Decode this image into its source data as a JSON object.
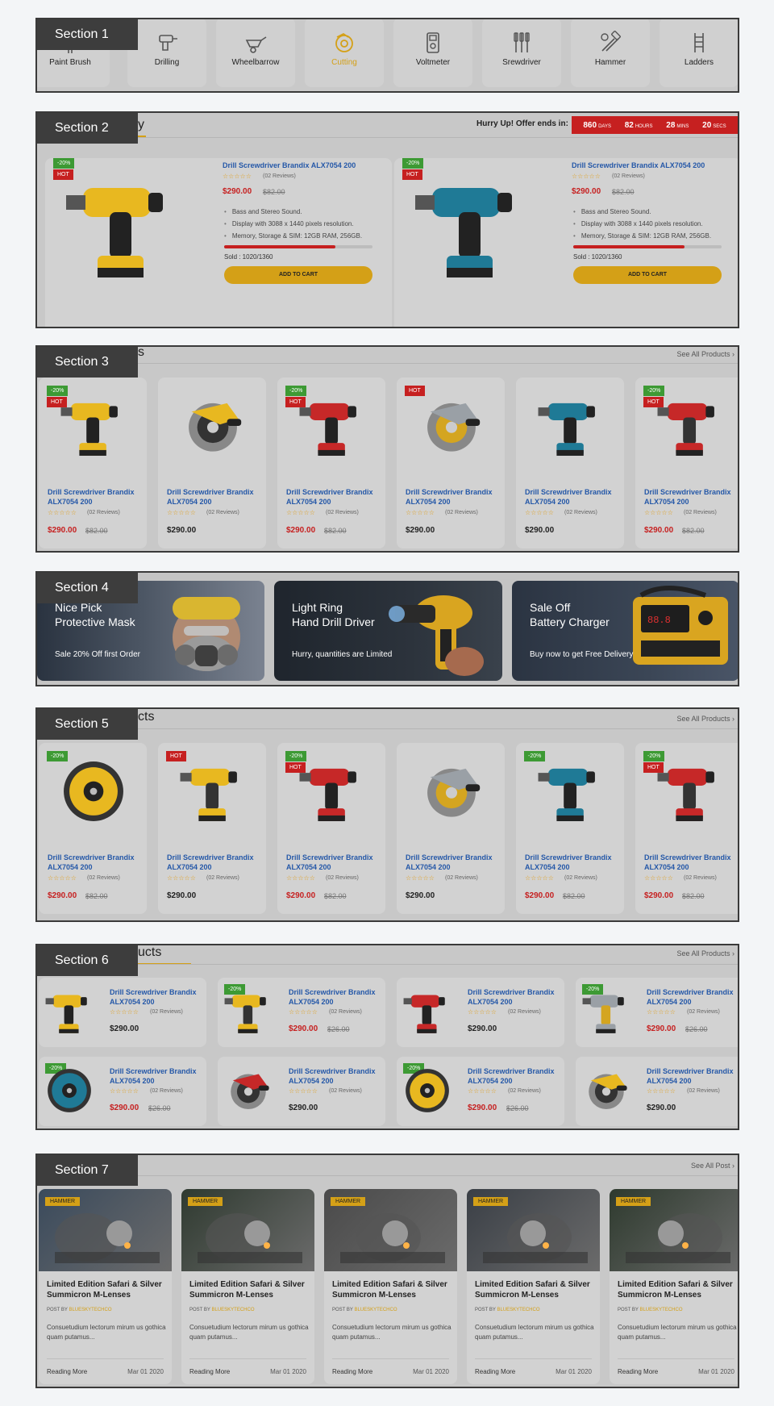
{
  "sections": [
    "Section 1",
    "Section 2",
    "Section 3",
    "Section 4",
    "Section 5",
    "Section 6",
    "Section 7"
  ],
  "categories": [
    {
      "label": "Paint Brush",
      "icon": "paint-brush-icon"
    },
    {
      "label": "Drilling",
      "icon": "drill-icon"
    },
    {
      "label": "Wheelbarrow",
      "icon": "wheelbarrow-icon"
    },
    {
      "label": "Cutting",
      "icon": "cutting-disc-icon",
      "active": true
    },
    {
      "label": "Voltmeter",
      "icon": "voltmeter-icon"
    },
    {
      "label": "Srewdriver",
      "icon": "screwdriver-icon"
    },
    {
      "label": "Hammer",
      "icon": "hammer-wrench-icon"
    },
    {
      "label": "Ladders",
      "icon": "ladder-icon"
    }
  ],
  "deal": {
    "heading_fragment": "y",
    "hurry_text": "Hurry Up! Offer ends in:",
    "countdown": [
      {
        "value": "860",
        "unit": "DAYS"
      },
      {
        "value": "82",
        "unit": "HOURS"
      },
      {
        "value": "28",
        "unit": "MINS"
      },
      {
        "value": "20",
        "unit": "SECS"
      }
    ],
    "cards": [
      {
        "badges": [
          "-20%",
          "HOT"
        ],
        "title": "Drill Screwdriver Brandix ALX7054 200",
        "stars": "☆☆☆☆☆",
        "reviews": "(02 Reviews)",
        "price": "$290.00",
        "old_price": "$82.00",
        "features": [
          "Bass and Stereo Sound.",
          "Display with 3088 x 1440 pixels resolution.",
          "Memory, Storage & SIM: 12GB RAM, 256GB."
        ],
        "sold_label": "Sold : 1020/1360",
        "sold_fraction": 0.75,
        "cart_label": "ADD TO CART",
        "image": "yellow-drill-icon"
      },
      {
        "badges": [
          "-20%",
          "HOT"
        ],
        "title": "Drill Screwdriver Brandix ALX7054 200",
        "stars": "☆☆☆☆☆",
        "reviews": "(02 Reviews)",
        "price": "$290.00",
        "old_price": "$82.00",
        "features": [
          "Bass and Stereo Sound.",
          "Display with 3088 x 1440 pixels resolution.",
          "Memory, Storage & SIM: 12GB RAM, 256GB."
        ],
        "sold_label": "Sold : 1020/1360",
        "sold_fraction": 0.75,
        "cart_label": "ADD TO CART",
        "image": "teal-drill-icon"
      }
    ]
  },
  "section3": {
    "heading_fragment": "s",
    "see_all": "See All Products",
    "products": [
      {
        "badges": [
          "-20%",
          "HOT"
        ],
        "name": "Drill Screwdriver Brandix ALX7054 200",
        "stars": "☆☆☆☆☆",
        "reviews": "(02 Reviews)",
        "price": "$290.00",
        "old_price": "$82.00",
        "sale": true
      },
      {
        "badges": [],
        "name": "Drill Screwdriver Brandix ALX7054 200",
        "stars": "☆☆☆☆☆",
        "reviews": "(02 Reviews)",
        "price": "$290.00",
        "old_price": "",
        "sale": false
      },
      {
        "badges": [
          "-20%",
          "HOT"
        ],
        "name": "Drill Screwdriver Brandix ALX7054 200",
        "stars": "☆☆☆☆☆",
        "reviews": "(02 Reviews)",
        "price": "$290.00",
        "old_price": "$82.00",
        "sale": true
      },
      {
        "badges": [
          "HOT"
        ],
        "name": "Drill Screwdriver Brandix ALX7054 200",
        "stars": "☆☆☆☆☆",
        "reviews": "(02 Reviews)",
        "price": "$290.00",
        "old_price": "",
        "sale": false
      },
      {
        "badges": [],
        "name": "Drill Screwdriver Brandix ALX7054 200",
        "stars": "☆☆☆☆☆",
        "reviews": "(02 Reviews)",
        "price": "$290.00",
        "old_price": "",
        "sale": false
      },
      {
        "badges": [
          "-20%",
          "HOT"
        ],
        "name": "Drill Screwdriver Brandix ALX7054 200",
        "stars": "☆☆☆☆☆",
        "reviews": "(02 Reviews)",
        "price": "$290.00",
        "old_price": "$82.00",
        "sale": true
      }
    ]
  },
  "banners": [
    {
      "title_line1": "Nice Pick",
      "title_line2": "Protective Mask",
      "subtitle": "Sale 20% Off first Order"
    },
    {
      "title_line1": "Light Ring",
      "title_line2": "Hand Drill Driver",
      "subtitle": "Hurry, quantities are Limited"
    },
    {
      "title_line1": "Sale Off",
      "title_line2": "Battery Charger",
      "subtitle": "Buy now to get Free Delivery"
    }
  ],
  "section5": {
    "heading_fragment": "cts",
    "see_all": "See All Products",
    "products": [
      {
        "badges": [
          "-20%"
        ],
        "name": "Drill Screwdriver Brandix ALX7054 200",
        "stars": "☆☆☆☆☆",
        "reviews": "(02 Reviews)",
        "price": "$290.00",
        "old_price": "$82.00",
        "sale": true
      },
      {
        "badges": [
          "HOT"
        ],
        "name": "Drill Screwdriver Brandix ALX7054 200",
        "stars": "☆☆☆☆☆",
        "reviews": "(02 Reviews)",
        "price": "$290.00",
        "old_price": "",
        "sale": false
      },
      {
        "badges": [
          "-20%",
          "HOT"
        ],
        "name": "Drill Screwdriver Brandix ALX7054 200",
        "stars": "☆☆☆☆☆",
        "reviews": "(02 Reviews)",
        "price": "$290.00",
        "old_price": "$82.00",
        "sale": true
      },
      {
        "badges": [],
        "name": "Drill Screwdriver Brandix ALX7054 200",
        "stars": "☆☆☆☆☆",
        "reviews": "(02 Reviews)",
        "price": "$290.00",
        "old_price": "",
        "sale": false
      },
      {
        "badges": [
          "-20%"
        ],
        "name": "Drill Screwdriver Brandix ALX7054 200",
        "stars": "☆☆☆☆☆",
        "reviews": "(02 Reviews)",
        "price": "$290.00",
        "old_price": "$82.00",
        "sale": true
      },
      {
        "badges": [
          "-20%",
          "HOT"
        ],
        "name": "Drill Screwdriver Brandix ALX7054 200",
        "stars": "☆☆☆☆☆",
        "reviews": "(02 Reviews)",
        "price": "$290.00",
        "old_price": "$82.00",
        "sale": true
      }
    ]
  },
  "section6": {
    "heading_fragment": "ucts",
    "see_all": "See All Products",
    "products": [
      {
        "badges": [],
        "name": "Drill Screwdriver Brandix ALX7054 200",
        "stars": "☆☆☆☆☆",
        "reviews": "(02 Reviews)",
        "price": "$290.00",
        "old_price": "",
        "sale": false
      },
      {
        "badges": [
          "-20%"
        ],
        "name": "Drill Screwdriver Brandix ALX7054 200",
        "stars": "☆☆☆☆☆",
        "reviews": "(02 Reviews)",
        "price": "$290.00",
        "old_price": "$26.00",
        "sale": true
      },
      {
        "badges": [],
        "name": "Drill Screwdriver Brandix ALX7054 200",
        "stars": "☆☆☆☆☆",
        "reviews": "(02 Reviews)",
        "price": "$290.00",
        "old_price": "",
        "sale": false
      },
      {
        "badges": [
          "-20%"
        ],
        "name": "Drill Screwdriver Brandix ALX7054 200",
        "stars": "☆☆☆☆☆",
        "reviews": "(02 Reviews)",
        "price": "$290.00",
        "old_price": "$26.00",
        "sale": true
      },
      {
        "badges": [
          "-20%"
        ],
        "name": "Drill Screwdriver Brandix ALX7054 200",
        "stars": "☆☆☆☆☆",
        "reviews": "(02 Reviews)",
        "price": "$290.00",
        "old_price": "$26.00",
        "sale": true
      },
      {
        "badges": [],
        "name": "Drill Screwdriver Brandix ALX7054 200",
        "stars": "☆☆☆☆☆",
        "reviews": "(02 Reviews)",
        "price": "$290.00",
        "old_price": "",
        "sale": false
      },
      {
        "badges": [
          "-20%"
        ],
        "name": "Drill Screwdriver Brandix ALX7054 200",
        "stars": "☆☆☆☆☆",
        "reviews": "(02 Reviews)",
        "price": "$290.00",
        "old_price": "$26.00",
        "sale": true
      },
      {
        "badges": [],
        "name": "Drill Screwdriver Brandix ALX7054 200",
        "stars": "☆☆☆☆☆",
        "reviews": "(02 Reviews)",
        "price": "$290.00",
        "old_price": "",
        "sale": false
      }
    ]
  },
  "blog": {
    "see_all": "See All Post",
    "posts": [
      {
        "tag": "HAMMER",
        "title": "Limited Edition Safari & Silver Summicron M-Lenses",
        "by_label": "POST BY",
        "author": "BLUESKYTECHCO",
        "excerpt": "Consuetudium lectorum mirum us gothica quam putamus...",
        "more": "Reading More",
        "date": "Mar 01 2020"
      },
      {
        "tag": "HAMMER",
        "title": "Limited Edition Safari & Silver Summicron M-Lenses",
        "by_label": "POST BY",
        "author": "BLUESKYTECHCO",
        "excerpt": "Consuetudium lectorum mirum us gothica quam putamus...",
        "more": "Reading More",
        "date": "Mar 01 2020"
      },
      {
        "tag": "HAMMER",
        "title": "Limited Edition Safari & Silver Summicron M-Lenses",
        "by_label": "POST BY",
        "author": "BLUESKYTECHCO",
        "excerpt": "Consuetudium lectorum mirum us gothica quam putamus...",
        "more": "Reading More",
        "date": "Mar 01 2020"
      },
      {
        "tag": "HAMMER",
        "title": "Limited Edition Safari & Silver Summicron M-Lenses",
        "by_label": "POST BY",
        "author": "BLUESKYTECHCO",
        "excerpt": "Consuetudium lectorum mirum us gothica quam putamus...",
        "more": "Reading More",
        "date": "Mar 01 2020"
      },
      {
        "tag": "HAMMER",
        "title": "Limited Edition Safari & Silver Summicron M-Lenses",
        "by_label": "POST BY",
        "author": "BLUESKYTECHCO",
        "excerpt": "Consuetudium lectorum mirum us gothica quam putamus...",
        "more": "Reading More",
        "date": "Mar 01 2020"
      }
    ]
  },
  "colors": {
    "accent": "#d4a017",
    "sale_red": "#c62020",
    "link_blue": "#2558a8",
    "badge_green": "#3d9a34"
  }
}
